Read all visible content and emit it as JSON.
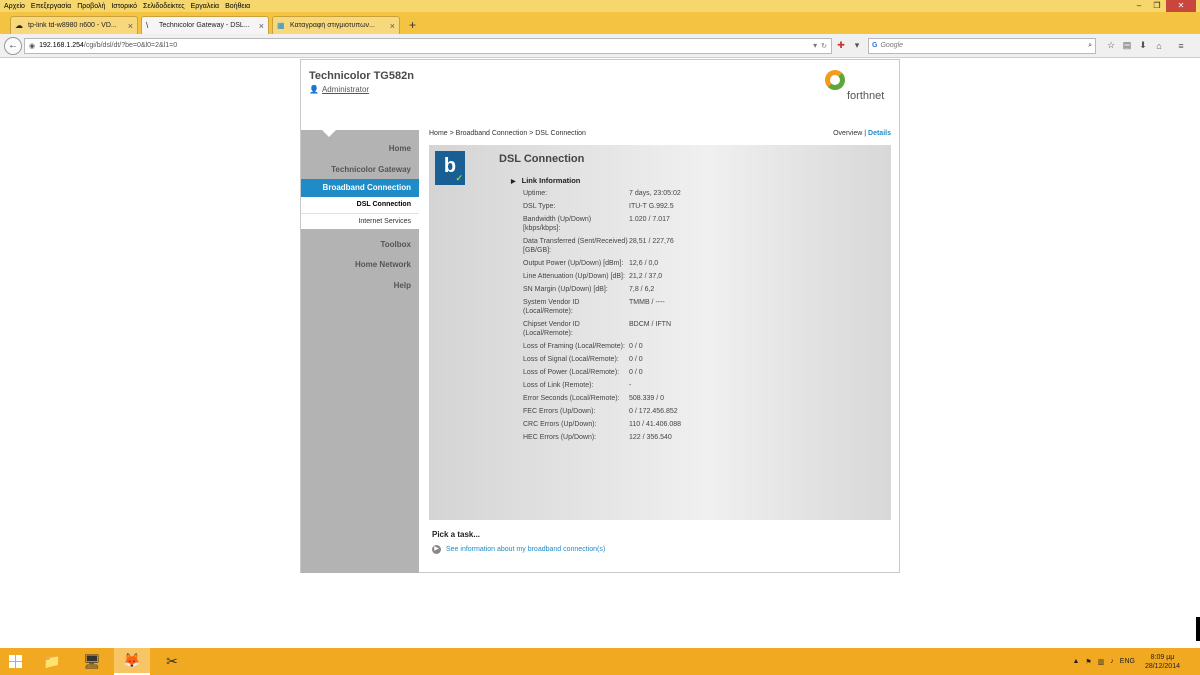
{
  "menubar": [
    "Αρχείο",
    "Επεξεργασία",
    "Προβολή",
    "Ιστορικό",
    "Σελιδοδείκτες",
    "Εργαλεία",
    "Βοήθεια"
  ],
  "tabs": [
    {
      "label": "tp-link td-w8980 n600 - VD...",
      "icon": "☁"
    },
    {
      "label": "Technicolor Gateway - DSL...",
      "icon": "\\"
    },
    {
      "label": "Καταγραφή στιγμιότυπων...",
      "icon": "▦"
    }
  ],
  "url": {
    "host": "192.168.1.254",
    "path": "/cgi/b/dsl/dt/?be=0&l0=2&l1=0"
  },
  "search": {
    "engine": "G",
    "placeholder": "Google"
  },
  "device": {
    "title": "Technicolor TG582n",
    "user": "Administrator",
    "brand": "forthnet"
  },
  "sidebar": {
    "items": [
      "Home",
      "Technicolor Gateway",
      "Broadband Connection",
      "Toolbox",
      "Home Network",
      "Help"
    ],
    "subitems": [
      "DSL Connection",
      "Internet Services"
    ]
  },
  "breadcrumb": "Home > Broadband Connection > DSL Connection",
  "views": {
    "overview": "Overview",
    "sep": "|",
    "details": "Details"
  },
  "panel": {
    "icon_letter": "b",
    "title": "DSL Connection",
    "section": "Link Information",
    "rows": [
      {
        "k": "Uptime:",
        "v": "7 days, 23:05:02"
      },
      {
        "k": "DSL Type:",
        "v": "ITU-T G.992.5"
      },
      {
        "k": "Bandwidth (Up/Down) [kbps/kbps]:",
        "v": "1.020 / 7.017"
      },
      {
        "k": "Data Transferred (Sent/Received) [GB/GB]:",
        "v": "28,51 / 227,76"
      },
      {
        "k": "Output Power (Up/Down) [dBm]:",
        "v": "12,6 / 0,0"
      },
      {
        "k": "Line Attenuation (Up/Down) [dB]:",
        "v": "21,2 / 37,0"
      },
      {
        "k": "SN Margin (Up/Down) [dB]:",
        "v": "7,8 / 6,2"
      },
      {
        "k": "System Vendor ID (Local/Remote):",
        "v": "TMMB / ----"
      },
      {
        "k": "Chipset Vendor ID (Local/Remote):",
        "v": "BDCM / IFTN"
      },
      {
        "k": "Loss of Framing (Local/Remote):",
        "v": "0 / 0"
      },
      {
        "k": "Loss of Signal (Local/Remote):",
        "v": "0 / 0"
      },
      {
        "k": "Loss of Power (Local/Remote):",
        "v": "0 / 0"
      },
      {
        "k": "Loss of Link (Remote):",
        "v": "-"
      },
      {
        "k": "Error Seconds (Local/Remote):",
        "v": "508.339 / 0"
      },
      {
        "k": "FEC Errors (Up/Down):",
        "v": "0 / 172.456.852"
      },
      {
        "k": "CRC Errors (Up/Down):",
        "v": "110 / 41.406.088"
      },
      {
        "k": "HEC Errors (Up/Down):",
        "v": "122 / 356.540"
      }
    ]
  },
  "task": {
    "title": "Pick a task...",
    "link": "See information about my broadband connection(s)"
  },
  "tray": {
    "lang": "ENG",
    "time": "8:09 μμ",
    "date": "28/12/2014"
  }
}
